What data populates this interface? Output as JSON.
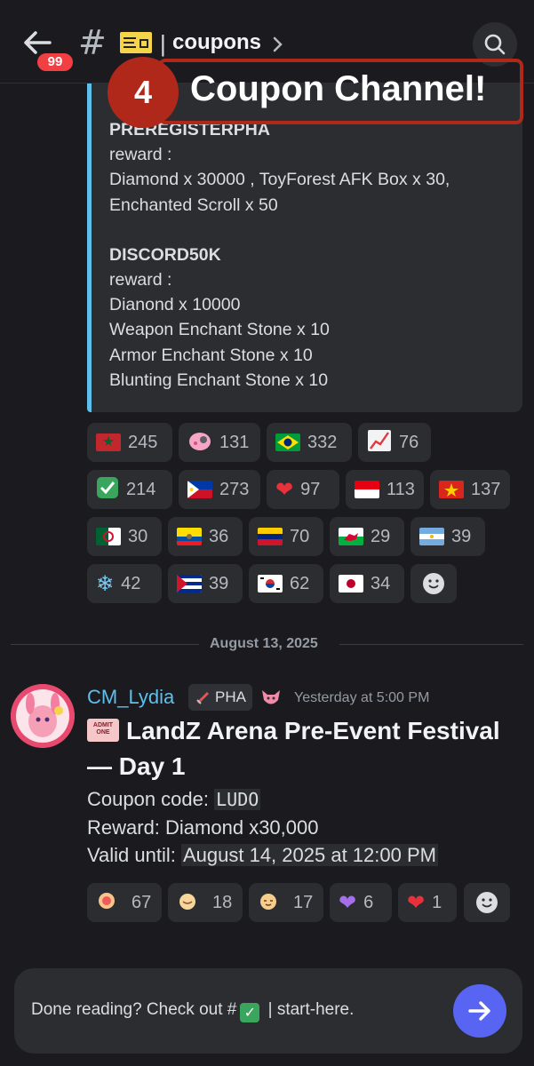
{
  "header": {
    "back_icon": "arrow-left-icon",
    "unread_badge": "99",
    "hash": "#",
    "channel_icon": "concert-ticket-icon",
    "separator": "|",
    "channel_name": "coupons",
    "search_icon": "search-icon"
  },
  "overlay": {
    "number": "4",
    "text": "Coupon Channel!",
    "color": "#b0281a"
  },
  "embed": {
    "accent_color": "#5ebfed",
    "code1": "PREREGISTERPHA",
    "reward_label1": "reward :",
    "reward1_line1": "Diamond x 30000 , ToyForest AFK Box x 30,",
    "reward1_line2": "Enchanted Scroll x 50",
    "code2": "DISCORD50K",
    "reward_label2": "reward :",
    "reward2_lines": [
      "Dianond x 10000",
      "Weapon Enchant Stone x 10",
      "Armor Enchant Stone x 10",
      "Blunting Enchant Stone x 10"
    ]
  },
  "reactions_top": [
    {
      "emoji": "flag-morocco",
      "count": "245"
    },
    {
      "emoji": "pink-blob",
      "count": "131"
    },
    {
      "emoji": "flag-brazil",
      "count": "332"
    },
    {
      "emoji": "chart-increasing",
      "count": "76"
    },
    {
      "emoji": "check-mark",
      "count": "214"
    },
    {
      "emoji": "flag-philippines",
      "count": "273"
    },
    {
      "emoji": "red-heart",
      "count": "97"
    },
    {
      "emoji": "flag-indonesia",
      "count": "113"
    },
    {
      "emoji": "flag-vietnam",
      "count": "137"
    },
    {
      "emoji": "flag-algeria",
      "count": "30"
    },
    {
      "emoji": "flag-ecuador",
      "count": "36"
    },
    {
      "emoji": "flag-venezuela",
      "count": "70"
    },
    {
      "emoji": "flag-wales",
      "count": "29"
    },
    {
      "emoji": "flag-argentina",
      "count": "39"
    },
    {
      "emoji": "snowflake",
      "count": "42"
    },
    {
      "emoji": "flag-cuba",
      "count": "39"
    },
    {
      "emoji": "flag-south-korea",
      "count": "62"
    },
    {
      "emoji": "flag-japan",
      "count": "34"
    }
  ],
  "date_divider": "August 13, 2025",
  "message": {
    "username": "CM_Lydia",
    "role_tag": "PHA",
    "timestamp": "Yesterday at 5:00 PM",
    "title": "LandZ Arena Pre-Event Festival — Day 1",
    "title_icon": "admit-one-ticket-icon",
    "ticket_text": "ADMIT ONE",
    "coupon_label": "Coupon code: ",
    "coupon_code": "LUDO",
    "reward_line": "Reward: Diamond x30,000",
    "valid_label": "Valid until: ",
    "valid_value": "August 14, 2025 at 12:00 PM"
  },
  "reactions_bottom": [
    {
      "emoji": "face-1",
      "count": "67"
    },
    {
      "emoji": "face-2",
      "count": "18"
    },
    {
      "emoji": "face-3",
      "count": "17"
    },
    {
      "emoji": "purple-heart",
      "count": "6"
    },
    {
      "emoji": "red-heart",
      "count": "1"
    }
  ],
  "composer": {
    "text_before": "Done reading? Check out #",
    "text_after": " | start-here.",
    "check": "✓",
    "send_color": "#5865f2"
  }
}
